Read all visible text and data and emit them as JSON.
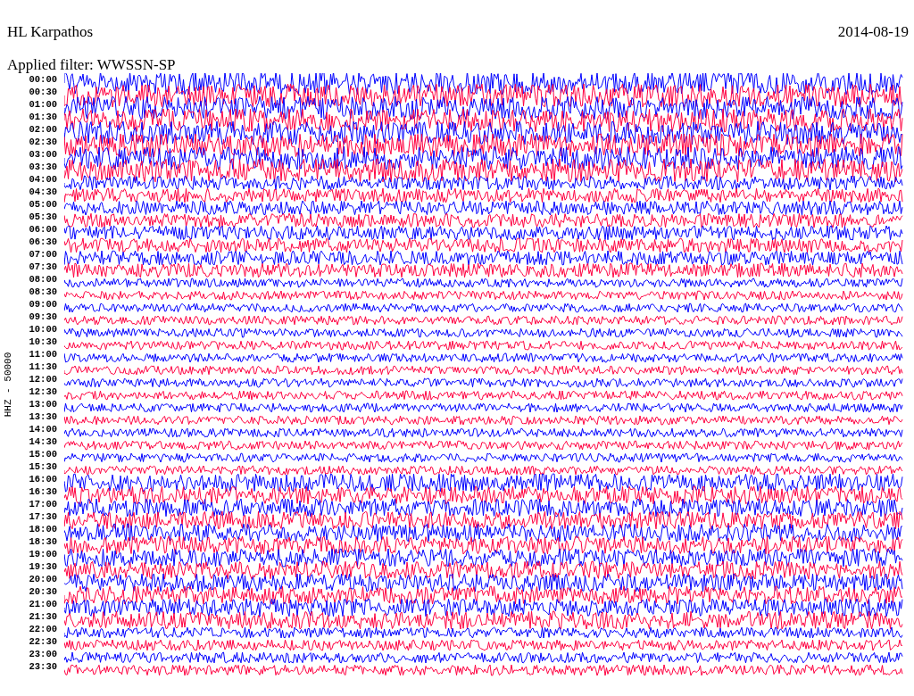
{
  "header": {
    "station": "HL Karpathos",
    "date": "2014-08-19",
    "filter": "Applied filter: WWSSN-SP"
  },
  "axis_label": "HHZ - 50000",
  "rows": [
    {
      "time": "00:00",
      "color": "#0000ff"
    },
    {
      "time": "00:30",
      "color": "#ff0040"
    },
    {
      "time": "01:00",
      "color": "#0000ff"
    },
    {
      "time": "01:30",
      "color": "#ff0040"
    },
    {
      "time": "02:00",
      "color": "#0000ff"
    },
    {
      "time": "02:30",
      "color": "#ff0040"
    },
    {
      "time": "03:00",
      "color": "#0000ff"
    },
    {
      "time": "03:30",
      "color": "#ff0040"
    },
    {
      "time": "04:00",
      "color": "#0000ff"
    },
    {
      "time": "04:30",
      "color": "#ff0040"
    },
    {
      "time": "05:00",
      "color": "#0000ff"
    },
    {
      "time": "05:30",
      "color": "#ff0040"
    },
    {
      "time": "06:00",
      "color": "#0000ff"
    },
    {
      "time": "06:30",
      "color": "#ff0040"
    },
    {
      "time": "07:00",
      "color": "#0000ff"
    },
    {
      "time": "07:30",
      "color": "#ff0040"
    },
    {
      "time": "08:00",
      "color": "#0000ff"
    },
    {
      "time": "08:30",
      "color": "#ff0040"
    },
    {
      "time": "09:00",
      "color": "#0000ff"
    },
    {
      "time": "09:30",
      "color": "#ff0040"
    },
    {
      "time": "10:00",
      "color": "#0000ff"
    },
    {
      "time": "10:30",
      "color": "#ff0040"
    },
    {
      "time": "11:00",
      "color": "#0000ff"
    },
    {
      "time": "11:30",
      "color": "#ff0040"
    },
    {
      "time": "12:00",
      "color": "#0000ff"
    },
    {
      "time": "12:30",
      "color": "#ff0040"
    },
    {
      "time": "13:00",
      "color": "#0000ff"
    },
    {
      "time": "13:30",
      "color": "#ff0040"
    },
    {
      "time": "14:00",
      "color": "#0000ff"
    },
    {
      "time": "14:30",
      "color": "#ff0040"
    },
    {
      "time": "15:00",
      "color": "#0000ff"
    },
    {
      "time": "15:30",
      "color": "#ff0040"
    },
    {
      "time": "16:00",
      "color": "#0000ff"
    },
    {
      "time": "16:30",
      "color": "#ff0040"
    },
    {
      "time": "17:00",
      "color": "#0000ff"
    },
    {
      "time": "17:30",
      "color": "#ff0040"
    },
    {
      "time": "18:00",
      "color": "#0000ff"
    },
    {
      "time": "18:30",
      "color": "#ff0040"
    },
    {
      "time": "19:00",
      "color": "#0000ff"
    },
    {
      "time": "19:30",
      "color": "#ff0040"
    },
    {
      "time": "20:00",
      "color": "#0000ff"
    },
    {
      "time": "20:30",
      "color": "#ff0040"
    },
    {
      "time": "21:00",
      "color": "#0000ff"
    },
    {
      "time": "21:30",
      "color": "#ff0040"
    },
    {
      "time": "22:00",
      "color": "#0000ff"
    },
    {
      "time": "22:30",
      "color": "#ff0040"
    },
    {
      "time": "23:00",
      "color": "#0000ff"
    },
    {
      "time": "23:30",
      "color": "#ff0040"
    }
  ]
}
